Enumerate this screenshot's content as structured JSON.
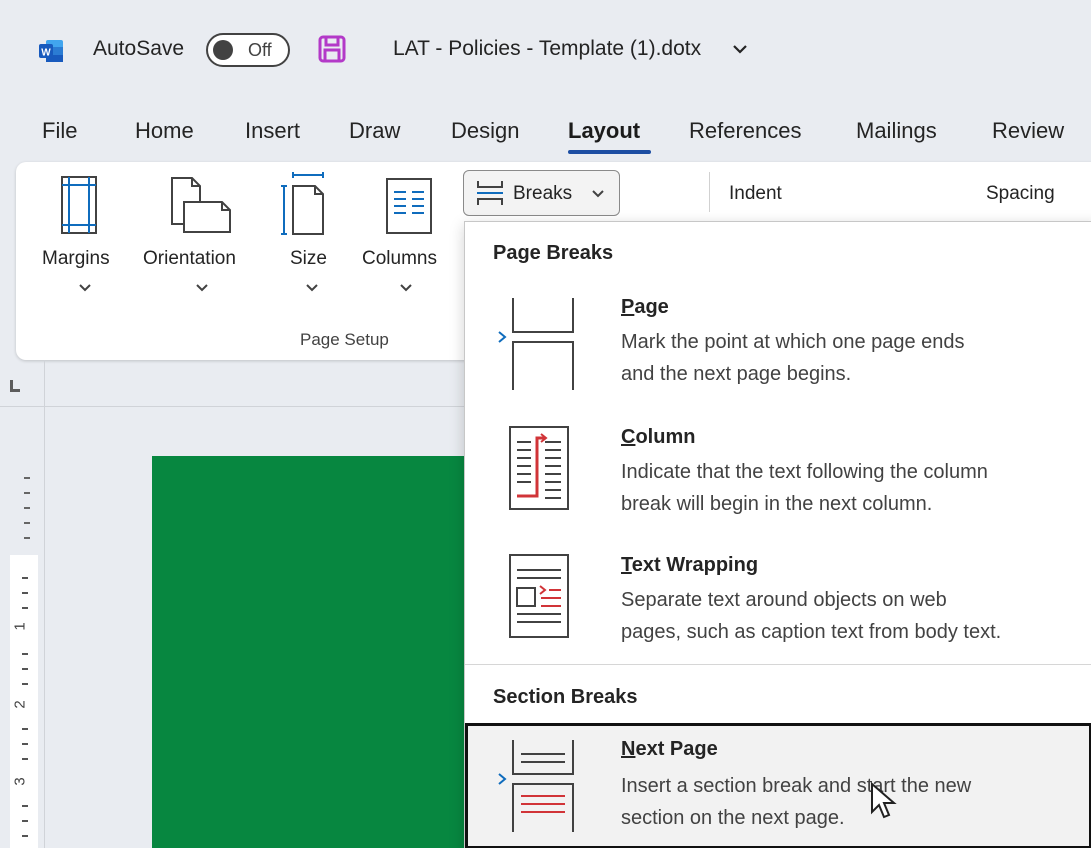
{
  "titlebar": {
    "app_icon": "word-logo-icon",
    "autosave_label": "AutoSave",
    "toggle_state": "Off",
    "save_icon": "save-icon",
    "document_title": "LAT - Policies - Template (1).dotx",
    "title_menu_icon": "chevron-down-icon"
  },
  "tabs": [
    "File",
    "Home",
    "Insert",
    "Draw",
    "Design",
    "Layout",
    "References",
    "Mailings",
    "Review"
  ],
  "active_tab": "Layout",
  "ribbon": {
    "margins": "Margins",
    "orientation": "Orientation",
    "size": "Size",
    "columns": "Columns",
    "group_label": "Page Setup",
    "breaks": "Breaks",
    "indent": "Indent",
    "spacing": "Spacing"
  },
  "ruler": {
    "numbers": [
      "1",
      "2",
      "3"
    ]
  },
  "menu": {
    "page_breaks_header": "Page Breaks",
    "section_breaks_header": "Section Breaks",
    "items": [
      {
        "key": "P",
        "rest": "age",
        "desc1": "Mark the point at which one page ends",
        "desc2": "and the next page begins.",
        "icon": "page-break-icon"
      },
      {
        "key": "C",
        "rest": "olumn",
        "desc1": "Indicate that the text following the column",
        "desc2": "break will begin in the next column.",
        "icon": "column-break-icon"
      },
      {
        "key": "T",
        "rest": "ext Wrapping",
        "desc1": "Separate text around objects on web",
        "desc2": "pages, such as caption text from body text.",
        "icon": "text-wrapping-icon"
      },
      {
        "key": "N",
        "rest": "ext Page",
        "desc1": "Insert a section break and start the new",
        "desc2": "section on the next page.",
        "icon": "next-page-break-icon"
      }
    ]
  },
  "colors": {
    "accent": "#1d4ea3",
    "green_page": "#078740",
    "save_icon": "#b339c8",
    "break_red": "#d13438",
    "icon_blue": "#0f6cbd"
  }
}
